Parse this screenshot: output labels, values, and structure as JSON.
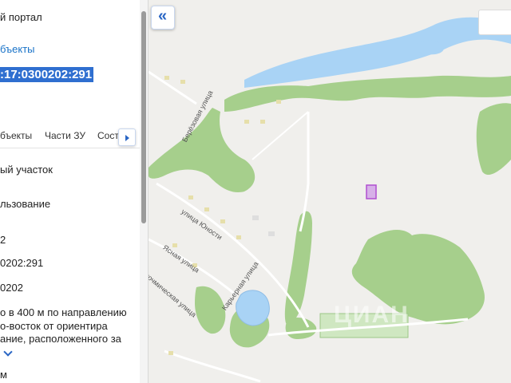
{
  "panel": {
    "title": "й портал",
    "back_link": "бъекты",
    "cadastral_number": ":17:0300202:291",
    "tabs": [
      "бъекты",
      "Части ЗУ",
      "Соста"
    ],
    "rows": [
      "ый участок",
      "льзование",
      "2",
      "0202:291",
      "0202",
      "о в 400 м по направлению",
      "о-восток от ориентира",
      "ание, расположенного за",
      "м"
    ]
  },
  "icons": {
    "collapse": "double-chevron-left-icon",
    "tab_scroll": "triangle-right-icon",
    "expand": "chevron-down-icon"
  },
  "map": {
    "streets": [
      "Берёзовая улица",
      "улица Юности",
      "Ясная улица",
      "Карьерная улица",
      "хочмическая улица"
    ],
    "watermark": "ЦИАН"
  },
  "colors": {
    "accent": "#2a66c4",
    "selection": "#2f6fd0",
    "forest": "#a6cf8c",
    "water": "#a9d3f5",
    "parcel": "#b04fd0"
  }
}
